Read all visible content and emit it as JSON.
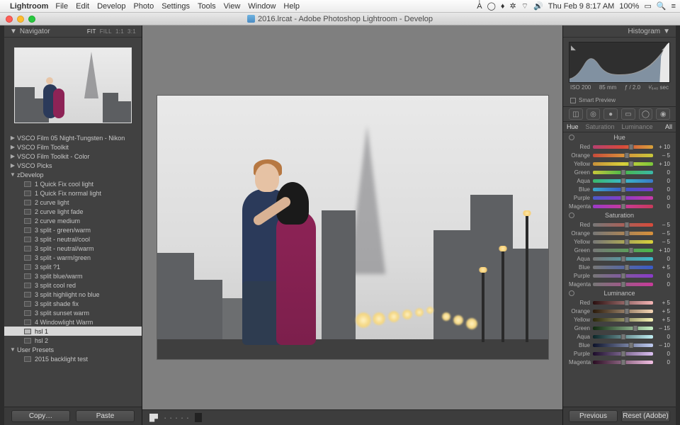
{
  "menubar": {
    "apple": "",
    "app": "Lightroom",
    "items": [
      "File",
      "Edit",
      "Develop",
      "Photo",
      "Settings",
      "Tools",
      "View",
      "Window",
      "Help"
    ],
    "right": {
      "clock": "Thu Feb 9  8:17 AM",
      "battery": "100%",
      "ai": "Aͥ"
    }
  },
  "window": {
    "title": "2016.lrcat - Adobe Photoshop Lightroom - Develop"
  },
  "navigator": {
    "title": "Navigator",
    "modes": [
      "FIT",
      "FILL",
      "1:1",
      "3:1"
    ],
    "active_mode": "FIT"
  },
  "presets": {
    "groups": [
      {
        "label": "VSCO Film 05 Night-Tungsten - Nikon",
        "collapsed": true
      },
      {
        "label": "VSCO Film Toolkit",
        "collapsed": true
      },
      {
        "label": "VSCO Film Toolkit - Color",
        "collapsed": true
      },
      {
        "label": "VSCO Picks",
        "collapsed": true
      },
      {
        "label": "zDevelop",
        "collapsed": false,
        "children": [
          "1 Quick Fix cool light",
          "1 Quick Fix normal light",
          "2 curve light",
          "2 curve light fade",
          "2 curve medium",
          "3 split - green/warm",
          "3 split - neutral/cool",
          "3 split - neutral/warm",
          "3 split - warm/green",
          "3 split ?1",
          "3 split blue/warm",
          "3 split cool red",
          "3 split highlight no blue",
          "3 split shade fix",
          "3 split sunset warm",
          "4 Windowlight Warm",
          "hsl 1",
          "hsl 2"
        ],
        "selected": "hsl 1"
      },
      {
        "label": "User Presets",
        "collapsed": false,
        "children": [
          "2015 backlight test"
        ]
      }
    ]
  },
  "left_buttons": {
    "copy": "Copy…",
    "paste": "Paste"
  },
  "toolbar_swatches": [
    "#c33",
    "#d9a23a",
    "#7bb23a",
    "#3a77c3",
    "#8b5fc3"
  ],
  "histogram": {
    "title": "Histogram",
    "exif": {
      "iso": "ISO 200",
      "focal": "85 mm",
      "aperture": "ƒ / 2.0",
      "shutter": "¹⁄₆₄₀ sec"
    },
    "smart": "Smart Preview"
  },
  "hsl_tabs": {
    "items": [
      "Hue",
      "Saturation",
      "Luminance"
    ],
    "all": "All",
    "active": "Hue"
  },
  "hsl": {
    "channels": [
      "Red",
      "Orange",
      "Yellow",
      "Green",
      "Aqua",
      "Blue",
      "Purple",
      "Magenta"
    ],
    "sections": [
      {
        "title": "Hue",
        "values": {
          "Red": "+ 10",
          "Orange": "– 5",
          "Yellow": "+ 10",
          "Green": "0",
          "Aqua": "0",
          "Blue": "0",
          "Purple": "0",
          "Magenta": "0"
        }
      },
      {
        "title": "Saturation",
        "values": {
          "Red": "– 5",
          "Orange": "– 5",
          "Yellow": "– 5",
          "Green": "+ 10",
          "Aqua": "0",
          "Blue": "+ 5",
          "Purple": "0",
          "Magenta": "0"
        }
      },
      {
        "title": "Luminance",
        "values": {
          "Red": "+ 5",
          "Orange": "+ 5",
          "Yellow": "+ 5",
          "Green": "– 15",
          "Aqua": "0",
          "Blue": "– 10",
          "Purple": "0",
          "Magenta": "0"
        }
      }
    ]
  },
  "slider_gradients": {
    "Hue": {
      "Red": "linear-gradient(90deg,#b6406f,#d84a3a,#d8a23a)",
      "Orange": "linear-gradient(90deg,#c84a3a,#d8903a,#c8c83a)",
      "Yellow": "linear-gradient(90deg,#c8903a,#d8d03a,#7ac83a)",
      "Green": "linear-gradient(90deg,#c8c83a,#4ab84a,#3ab8a8)",
      "Aqua": "linear-gradient(90deg,#3ab86a,#3ab8c8,#3a7ac8)",
      "Blue": "linear-gradient(90deg,#3aa8c8,#3a5ac8,#7a3ac8)",
      "Purple": "linear-gradient(90deg,#4a5ac8,#8a3ac8,#c83aa8)",
      "Magenta": "linear-gradient(90deg,#9a3ac8,#c83a9a,#c83a5a)"
    },
    "Saturation": {
      "Red": "linear-gradient(90deg,#777,#d84a3a)",
      "Orange": "linear-gradient(90deg,#777,#d8903a)",
      "Yellow": "linear-gradient(90deg,#777,#d8d03a)",
      "Green": "linear-gradient(90deg,#777,#4ab84a)",
      "Aqua": "linear-gradient(90deg,#777,#3ab8c8)",
      "Blue": "linear-gradient(90deg,#777,#3a5ac8)",
      "Purple": "linear-gradient(90deg,#777,#8a3ac8)",
      "Magenta": "linear-gradient(90deg,#777,#c83a9a)"
    },
    "Luminance": {
      "Red": "linear-gradient(90deg,#2a0f0f,#f5b5b5)",
      "Orange": "linear-gradient(90deg,#2a1a0a,#f5d5b5)",
      "Yellow": "linear-gradient(90deg,#2a280a,#f5f2b5)",
      "Green": "linear-gradient(90deg,#0f2a0f,#c5f0c5)",
      "Aqua": "linear-gradient(90deg,#0a2628,#c0eef2)",
      "Blue": "linear-gradient(90deg,#0c122a,#c0ccf2)",
      "Purple": "linear-gradient(90deg,#1c0c2a,#dcc0f2)",
      "Magenta": "linear-gradient(90deg,#2a0c22,#f2c0e4)"
    }
  },
  "right_buttons": {
    "prev": "Previous",
    "reset": "Reset (Adobe)"
  }
}
